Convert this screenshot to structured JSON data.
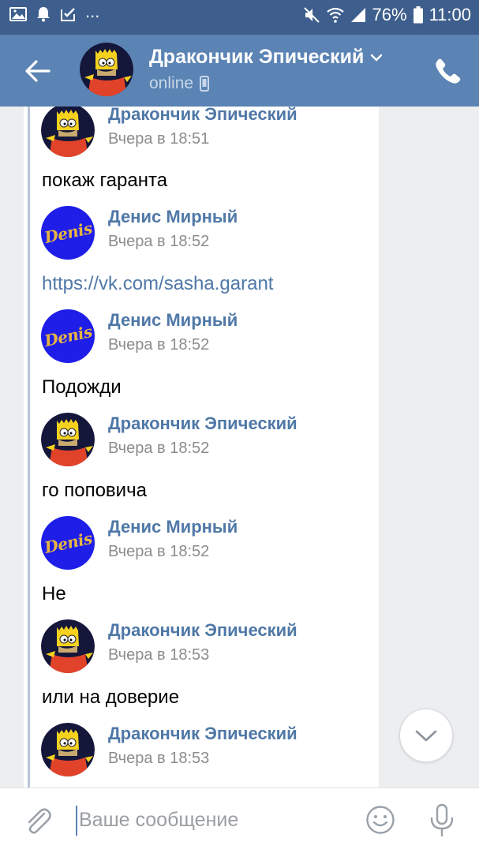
{
  "status_bar": {
    "battery": "76%",
    "time": "11:00",
    "dots": "..."
  },
  "header": {
    "contact_name": "Дракончик Эпический",
    "status": "online"
  },
  "messages": [
    {
      "author": "Дракончик Эпический",
      "time": "Вчера в 18:51",
      "text": "покаж гаранта"
    },
    {
      "author": "Денис Мирный",
      "time": "Вчера в 18:52",
      "text": "https://vk.com/sasha.garant"
    },
    {
      "author": "Денис Мирный",
      "time": "Вчера в 18:52",
      "text": "Подожди"
    },
    {
      "author": "Дракончик Эпический",
      "time": "Вчера в 18:52",
      "text": "го поповича"
    },
    {
      "author": "Денис Мирный",
      "time": "Вчера в 18:52",
      "text": "Не"
    },
    {
      "author": "Дракончик Эпический",
      "time": "Вчера в 18:53",
      "text": "или на доверие"
    },
    {
      "author": "Дракончик Эпический",
      "time": "Вчера в 18:53",
      "text": ""
    }
  ],
  "avatars": {
    "denis_logo": "Denis"
  },
  "composer": {
    "placeholder": "Ваше сообщение"
  },
  "icons": {
    "back": "arrow-left-icon",
    "call": "phone-icon",
    "scroll_down": "chevron-down-icon",
    "attach": "paperclip-icon",
    "emoji": "smiley-icon",
    "mic": "microphone-icon"
  },
  "colors": {
    "header_bg": "#5b83b4",
    "status_bar_bg": "#3e5f8d",
    "author_name": "#4f78a7",
    "link": "#4f78a7",
    "denis_avatar_bg": "#1e1ee8",
    "denis_logo": "#e8b640"
  }
}
